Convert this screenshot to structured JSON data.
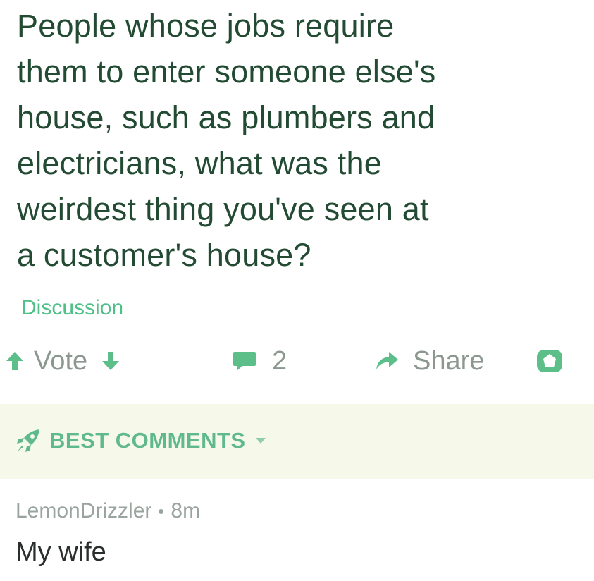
{
  "post": {
    "title_lines": [
      "People whose jobs require",
      "them to enter someone else's",
      "house, such as plumbers and",
      "electricians, what was the",
      "weirdest thing you've seen at",
      "a customer's house?"
    ],
    "flair": "Discussion"
  },
  "actions": {
    "vote_label": "Vote",
    "comment_count": "2",
    "share_label": "Share"
  },
  "sort": {
    "label": "BEST COMMENTS"
  },
  "comment": {
    "author": "LemonDrizzler",
    "age": "8m",
    "body": "My wife"
  },
  "colors": {
    "title": "#234a33",
    "accent_green": "#4fc088",
    "muted_gray": "#8b978f",
    "best_bar_bg": "#f6f9ea"
  },
  "icons": {
    "upvote": "arrow-up-icon",
    "downvote": "arrow-down-icon",
    "comment": "comment-bubble-icon",
    "share": "share-arrow-icon",
    "save": "save-shape-icon",
    "best": "rocket-icon",
    "sort_caret": "chevron-down-icon"
  }
}
